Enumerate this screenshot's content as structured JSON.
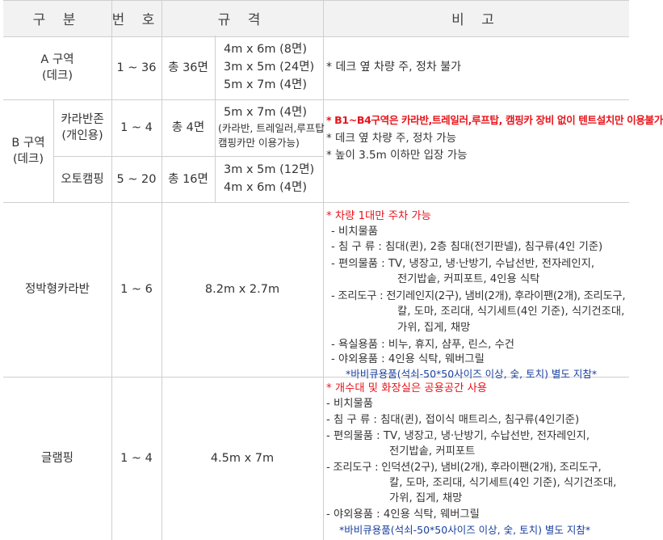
{
  "header": {
    "category": "구 분",
    "number": "번 호",
    "spec": "규 격",
    "remarks": "비 고"
  },
  "zone_a": {
    "name_line1": "A 구역",
    "name_line2": "(데크)",
    "number": "1 ~ 36",
    "total": "총 36면",
    "sizes": [
      "4m x 6m (8면)",
      "3m x 5m (24면)",
      "5m x 7m (4면)"
    ],
    "remark": "* 데크 옆 차량 주, 정차 불가"
  },
  "zone_b": {
    "name_line1": "B 구역",
    "name_line2": "(데크)",
    "caravan_zone": {
      "name_line1": "카라반존",
      "name_line2": "(개인용)",
      "number": "1 ~ 4",
      "total": "총 4면",
      "size": "5m x 7m (4면)",
      "size_note_line1": "(카라반, 트레일러,루프탑",
      "size_note_line2": "캠핑카만 이용가능)"
    },
    "auto_camping": {
      "name": "오토캠핑",
      "number": "5 ~ 20",
      "total": "총 16면",
      "sizes": [
        "3m x 5m (12면)",
        "4m x 6m (4면)"
      ]
    },
    "remarks": [
      "* B1~B4구역은 카라반,트레일러,루프탑, 캠핑카 장비 없이 텐트설치만 이용불가",
      "* 데크 옆 차량 주, 정차 가능",
      "* 높이 3.5m 이하만 입장 가능"
    ]
  },
  "caravan": {
    "name": "정박형카라반",
    "number": "1 ~ 6",
    "size": "8.2m x 2.7m",
    "notice": "* 차량 1대만 주차 가능",
    "items": [
      "- 비치물품",
      "- 침 구 류 : 침대(퀸), 2층 침대(전기판넬), 침구류(4인 기준)",
      "- 편의물품 : TV, 냉장고, 냉·난방기, 수납선반, 전자레인지,",
      "전기밥솥, 커피포트, 4인용 식탁",
      "- 조리도구 : 전기레인지(2구), 냄비(2개), 후라이팬(2개), 조리도구,",
      "칼, 도마, 조리대, 식기세트(4인 기준), 식기건조대,",
      "가위, 집게, 채망",
      "- 욕실용품 : 비누, 휴지, 샴푸, 린스, 수건",
      "- 야외용품 : 4인용 식탁, 웨버그릴"
    ],
    "bbq_note": "*바비큐용품(석쇠-50*50사이즈 이상, 숯, 토치) 별도 지참*"
  },
  "glamping": {
    "name": "글램핑",
    "number": "1 ~ 4",
    "size": "4.5m x 7m",
    "notice": "* 개수대 및 화장실은 공용공간 사용",
    "items": [
      "- 비치물품",
      "- 침 구 류 : 침대(퀸), 접이식 매트리스, 침구류(4인기준)",
      "- 편의물품 : TV, 냉장고, 냉·난방기, 수납선반, 전자레인지,",
      "전기밥솥, 커피포트",
      "- 조리도구 : 인덕션(2구), 냄비(2개), 후라이팬(2개), 조리도구,",
      "칼, 도마, 조리대, 식기세트(4인 기준), 식기건조대,",
      "가위, 집게, 채망",
      "- 야외용품 : 4인용 식탁, 웨버그릴"
    ],
    "bbq_note": "*바비큐용품(석쇠-50*50사이즈 이상, 숯, 토치) 별도 지참*"
  }
}
